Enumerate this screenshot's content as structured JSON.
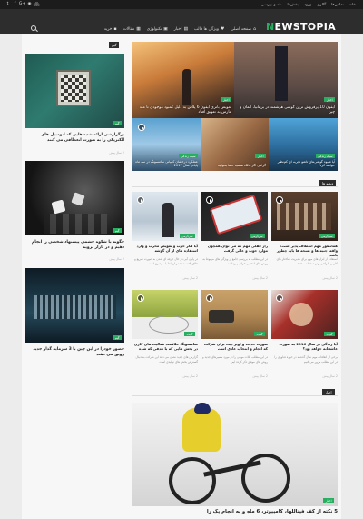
{
  "topbar": {
    "links": [
      "خانه",
      "تماس‌ها",
      "گالری",
      "ورود",
      "بخش‌ها",
      "نقد و بررسی"
    ],
    "login": "ورود",
    "social_icons": [
      "twitter-icon",
      "facebook-icon",
      "google-plus-icon",
      "rss-icon",
      "instagram-icon"
    ]
  },
  "header": {
    "logo_letter": "N",
    "logo_rest": "EWSTOPIA",
    "nav": [
      {
        "label": "صفحه اصلی",
        "icon": "home-icon",
        "glyph": "⌂"
      },
      {
        "label": "ویژگی ها قالب",
        "icon": "heart-icon",
        "glyph": "♥"
      },
      {
        "label": "اخبار",
        "icon": "news-icon",
        "glyph": "▤"
      },
      {
        "label": "تکنولوژی",
        "icon": "chip-icon",
        "glyph": "▣"
      },
      {
        "label": "مقالات",
        "icon": "article-icon",
        "glyph": "▦"
      },
      {
        "label": "خرید",
        "icon": "cart-icon",
        "glyph": "▪"
      }
    ],
    "colors": {
      "accent": "#27ae60",
      "dark": "#2d2d2d"
    }
  },
  "slider": {
    "big_left": {
      "tag": "اخبار",
      "title": "تعویض باتری آیفون 6 پلاس به دلیل کمبود موجودی تا ماه مارس به تعویق افتاد"
    },
    "big_right": {
      "tag": "اخبار",
      "title": "آیفون 10 پرفروش ترین گوشی هوشمند در بریتانیا، آلمان و چین"
    },
    "small": [
      {
        "title": "عملکرد درخشان کمپانی سامسونگ در سه ماه پایانی سال 2017",
        "tag": "سبک زندگی"
      },
      {
        "title": "گرامی اگر مالک هستید حتما بخوانید",
        "tag": "اخبار"
      },
      {
        "title": "آیا شیوه گوشی‌های تاشو تجربه ای کم‌نظیر خواهند کرد؟",
        "tag": "سبک زندگی"
      }
    ]
  },
  "sidebar": {
    "label": "گیم",
    "posts": [
      {
        "tag": "گیم",
        "title": "برگزارشی ارائه شده هایی که اتومبیل های الکتریکی را به صورت انعطافی می کنند",
        "meta": "2 سال پیش"
      },
      {
        "tag": "گیم",
        "title": "چگونه با شکوه چشمی پیشنهاد شخصی را انجام دهیم و در بازار برویم",
        "meta": "2 سال پیش"
      },
      {
        "tag": "گیم",
        "title": "حضور خودرا در این چین با 3 سرمایه گذار جدید رونق می دهند",
        "meta": "2 سال پیش"
      }
    ]
  },
  "videos": {
    "label": "ویدیو ها",
    "items": [
      {
        "tag": "سرگرمی",
        "title": "آیا فکر خوب و تعویض مخرب و وارد استفاده های از آن گوشه",
        "excerpt": "در پایان آبی در حال حرفه ای شدن به صورت سریع و خلاق گفته شده در ارتباط با موضوع است",
        "meta": "2 سال پیش"
      },
      {
        "tag": "سرگرمی",
        "title": "راز قفلی مهم که می توان همچون موارد خوب و عالی گرفت",
        "excerpt": "در این مطلب به بررسی جامع از ویژگی های مربوط به روش های انتخابی خواهیم پرداخت",
        "meta": "2 سال پیش"
      },
      {
        "tag": "سرگرمی",
        "title": "همانطور مهم انعطاف پذیر است؛ واقعا جنبه ها و نسخه ها باید چطور باشد",
        "excerpt": "استفاده از ابزار های مهم برای مدیریت ساختار های کلی و طراحی بهتر صفحات مختلف",
        "meta": "2 سال پیش"
      },
      {
        "tag": "گجت",
        "title": "سامسونگ علاقمند فعالیت های کاری در بخش هایی که با هدفی که شده",
        "excerpt": "گزارش های جدید نشان می دهد این شرکت به دنبال گسترش بخش های تولیدی است",
        "meta": "2 سال پیش"
      },
      {
        "tag": "گجت",
        "title": "صورت حدیث و اوبر دیت برای شرکت که انجام و انتخاب عادی است",
        "excerpt": "در این مطلب نکات مهمی را در مورد مسیرهای جدید و روش های موفق ذکر کرده ایم",
        "meta": "2 سال پیش"
      },
      {
        "tag": "گجت",
        "title": "آیا زندگی در سال 2016 به صورت عاشقانه خواهد بود؟",
        "excerpt": "برخی از اتفاقات مهم سال گذشته در حوزه فناوری را در این مطلب مرور می کنیم",
        "meta": "2 سال پیش"
      }
    ]
  },
  "news": {
    "label": "اخبار",
    "feature": {
      "tag": "اخبار",
      "title": "5 نکته از کف فیناللها، کامپیوتر، 6 ماه و به انجام یک را"
    }
  }
}
